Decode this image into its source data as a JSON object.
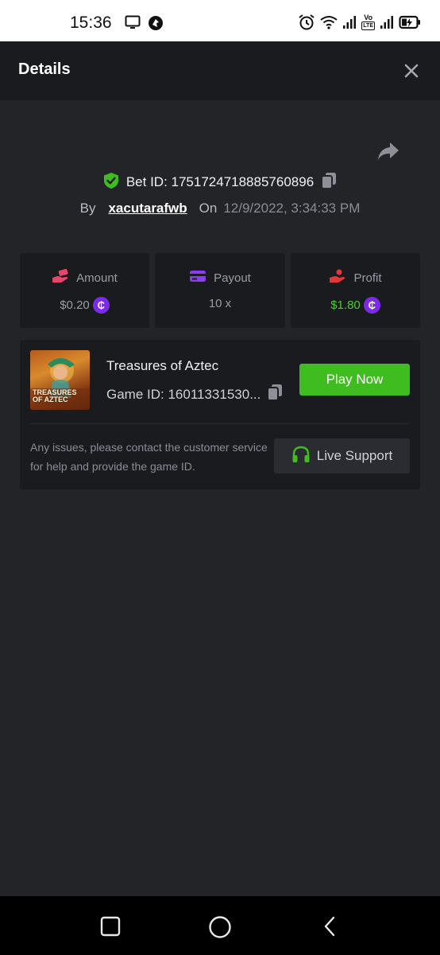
{
  "status_bar": {
    "time": "15:36",
    "left_icons": [
      "screen-icon",
      "app-notification-icon"
    ],
    "right_icons": [
      "alarm-icon",
      "wifi-icon",
      "signal-icon",
      "volte-icon",
      "signal-icon",
      "battery-charging-icon"
    ],
    "volte_top": "Vo",
    "volte_bottom": "LTE"
  },
  "header": {
    "title": "Details",
    "close_icon": "close-icon"
  },
  "bet": {
    "share_icon": "share-icon",
    "verified_icon": "shield-check-icon",
    "bet_id_label": "Bet ID: 1751724718885760896",
    "copy_icon": "copy-icon",
    "by_label": "By",
    "username": "xacutarafwb",
    "on_label": "On",
    "date": "12/9/2022, 3:34:33 PM"
  },
  "stats": [
    {
      "key": "amount",
      "label": "Amount",
      "value": "$0.20",
      "icon": "money-hand-icon",
      "coin": "₵"
    },
    {
      "key": "payout",
      "label": "Payout",
      "value": "10 x",
      "icon": "card-icon"
    },
    {
      "key": "profit",
      "label": "Profit",
      "value": "$1.80",
      "icon": "profit-hand-icon",
      "coin": "₵"
    }
  ],
  "game": {
    "thumbnail_text": "TREASURES OF AZTEC",
    "title": "Treasures of Aztec",
    "game_id": "Game ID: 16011331530...",
    "play_button": "Play Now",
    "issue_text": "Any issues, please contact the customer service for help and provide the game ID.",
    "support_button": "Live Support",
    "support_icon": "headset-icon"
  },
  "colors": {
    "background": "#232428",
    "card": "#1a1b1e",
    "accent_green": "#3fbc1f",
    "profit_green": "#49cd2c",
    "coin_purple": "#7c2ae8"
  },
  "nav_bar": {
    "buttons": [
      "recents-square-icon",
      "home-circle-icon",
      "back-chevron-icon"
    ]
  }
}
